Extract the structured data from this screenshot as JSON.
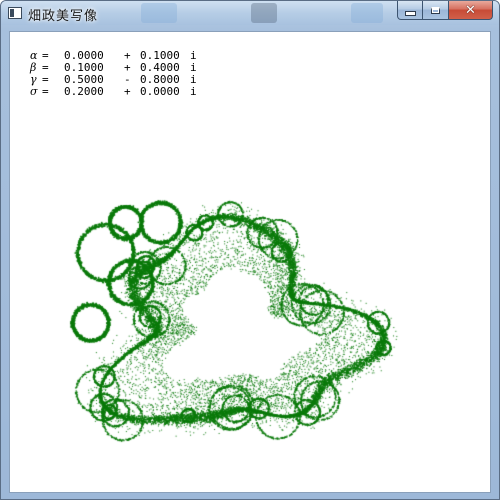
{
  "window": {
    "title": "畑政美写像",
    "caption_buttons": {
      "minimize_icon": "minimize-icon",
      "maximize_icon": "maximize-icon",
      "close_icon": "close-icon",
      "close_glyph": "✕"
    }
  },
  "parameters": [
    {
      "symbol": "α",
      "eq": "=",
      "re": "0.0000",
      "op": "+",
      "im": "0.1000",
      "unit": "i"
    },
    {
      "symbol": "β",
      "eq": "=",
      "re": "0.1000",
      "op": "+",
      "im": "0.4000",
      "unit": "i"
    },
    {
      "symbol": "γ",
      "eq": "=",
      "re": "0.5000",
      "op": "-",
      "im": "0.8000",
      "unit": "i"
    },
    {
      "symbol": "σ",
      "eq": "=",
      "re": "0.2000",
      "op": "+",
      "im": "0.0000",
      "unit": "i"
    }
  ],
  "fractal": {
    "color": "#0b7a0b"
  }
}
